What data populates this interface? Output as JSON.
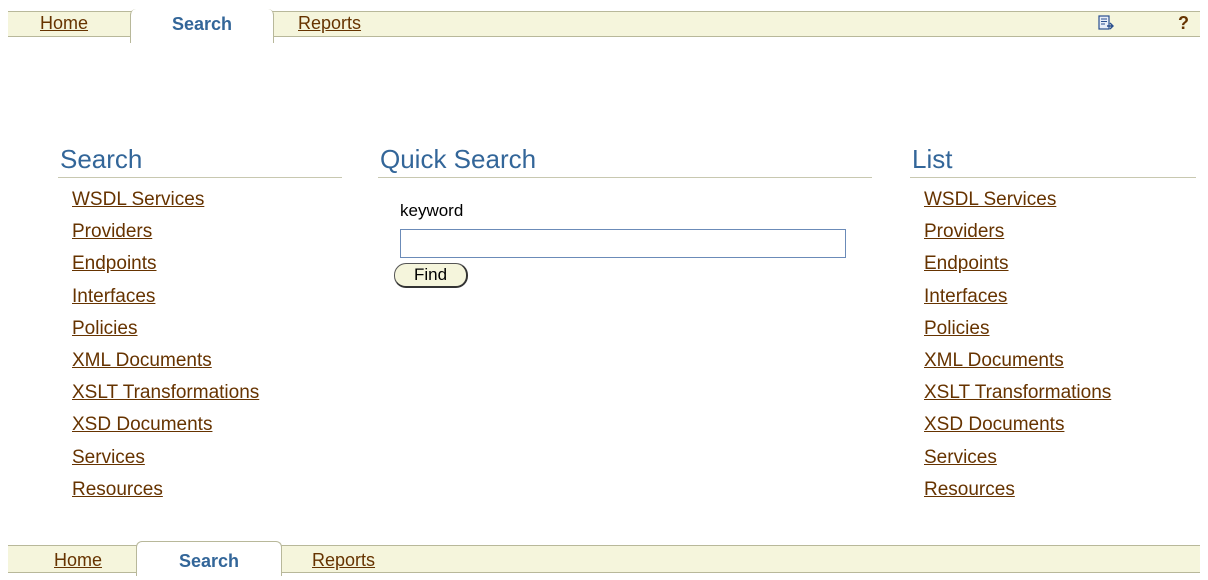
{
  "tabs": {
    "home": "Home",
    "search": "Search",
    "reports": "Reports"
  },
  "global": {
    "doc_icon": "document-icon",
    "help": "?"
  },
  "search_section": {
    "title": "Search",
    "links": [
      "WSDL Services",
      "Providers",
      "Endpoints",
      "Interfaces",
      "Policies",
      "XML Documents",
      "XSLT Transformations",
      "XSD Documents",
      "Services",
      "Resources"
    ]
  },
  "quick_search": {
    "title": "Quick Search",
    "keyword_label": "keyword",
    "keyword_value": "",
    "find_label": "Find"
  },
  "list_section": {
    "title": "List",
    "links": [
      "WSDL Services",
      "Providers",
      "Endpoints",
      "Interfaces",
      "Policies",
      "XML Documents",
      "XSLT Transformations",
      "XSD Documents",
      "Services",
      "Resources"
    ]
  },
  "colors": {
    "link": "#663300",
    "heading": "#336699",
    "tabbar_bg": "#f5f5dc"
  }
}
